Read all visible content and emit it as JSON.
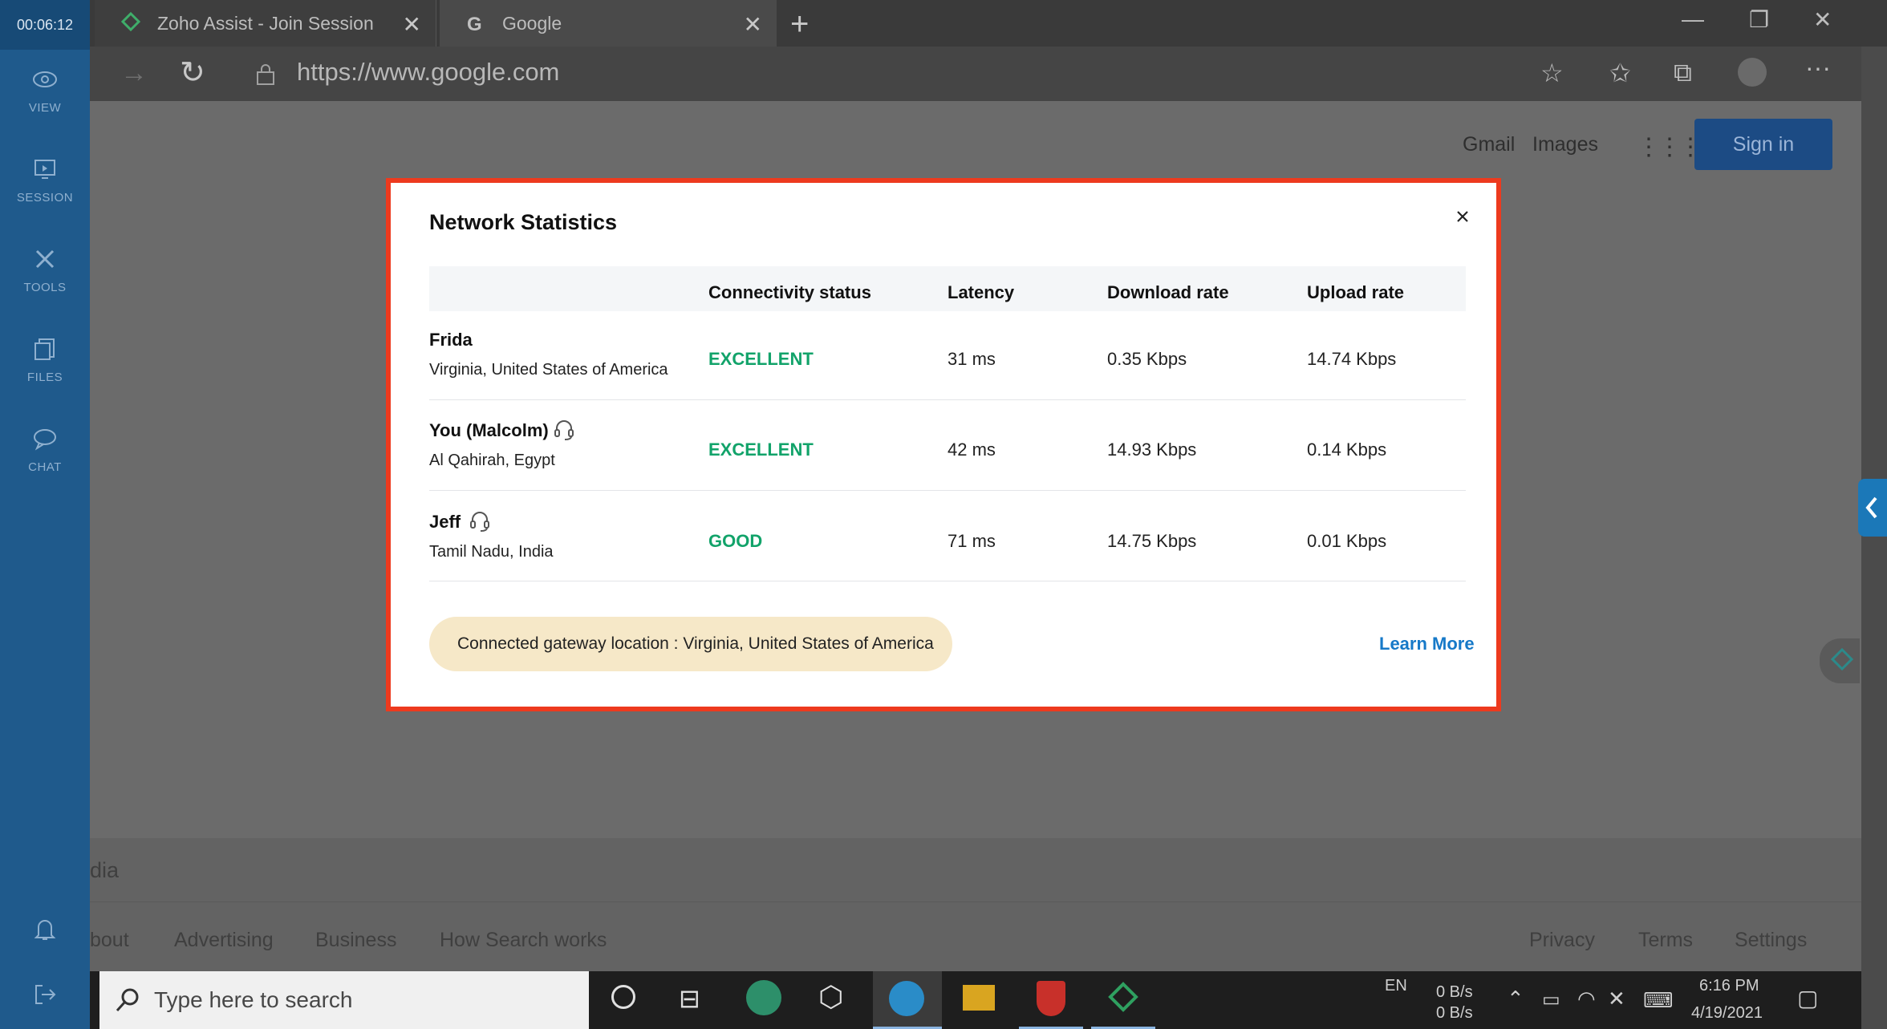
{
  "session": {
    "timer": "00:06:12"
  },
  "sidebar": {
    "items": [
      {
        "label": "VIEW",
        "icon": "eye-icon"
      },
      {
        "label": "SESSION",
        "icon": "session-icon"
      },
      {
        "label": "TOOLS",
        "icon": "tools-icon"
      },
      {
        "label": "FILES",
        "icon": "files-icon"
      },
      {
        "label": "CHAT",
        "icon": "chat-icon"
      }
    ]
  },
  "browser": {
    "tabs": [
      {
        "title": "Zoho Assist - Join Session",
        "icon": "zoho-icon"
      },
      {
        "title": "Google",
        "icon": "google-icon"
      }
    ],
    "url": "https://www.google.com"
  },
  "google": {
    "header": {
      "gmail": "Gmail",
      "images": "Images",
      "sign_in": "Sign in"
    },
    "footer": {
      "country": "dia",
      "left_links": [
        "bout",
        "Advertising",
        "Business",
        "How Search works"
      ],
      "right_links": [
        "Privacy",
        "Terms",
        "Settings"
      ]
    }
  },
  "dialog": {
    "title": "Network Statistics",
    "columns": [
      "Connectivity status",
      "Latency",
      "Download rate",
      "Upload rate"
    ],
    "rows": [
      {
        "name": "Frida",
        "location": "Virginia, United States of America",
        "status": "EXCELLENT",
        "latency": "31 ms",
        "download": "0.35 Kbps",
        "upload": "14.74 Kbps"
      },
      {
        "name": "You (Malcolm)",
        "location": "Al Qahirah, Egypt",
        "status": "EXCELLENT",
        "latency": "42 ms",
        "download": "14.93 Kbps",
        "upload": "0.14 Kbps"
      },
      {
        "name": "Jeff",
        "location": "Tamil Nadu, India",
        "status": "GOOD",
        "latency": "71 ms",
        "download": "14.75 Kbps",
        "upload": "0.01 Kbps"
      }
    ],
    "gateway": "Connected gateway location : Virginia, United States of America",
    "learn_more": "Learn More"
  },
  "taskbar": {
    "search_placeholder": "Type here to search",
    "lang": "EN",
    "net_up": "0 B/s",
    "net_down": "0 B/s",
    "time": "6:16 PM",
    "date": "4/19/2021"
  },
  "colors": {
    "accent": "#1f5a8c",
    "highlight": "#ed3a1e",
    "status_green": "#12a36a",
    "link_blue": "#1679c8",
    "gateway_bg": "#f6e8c8"
  }
}
